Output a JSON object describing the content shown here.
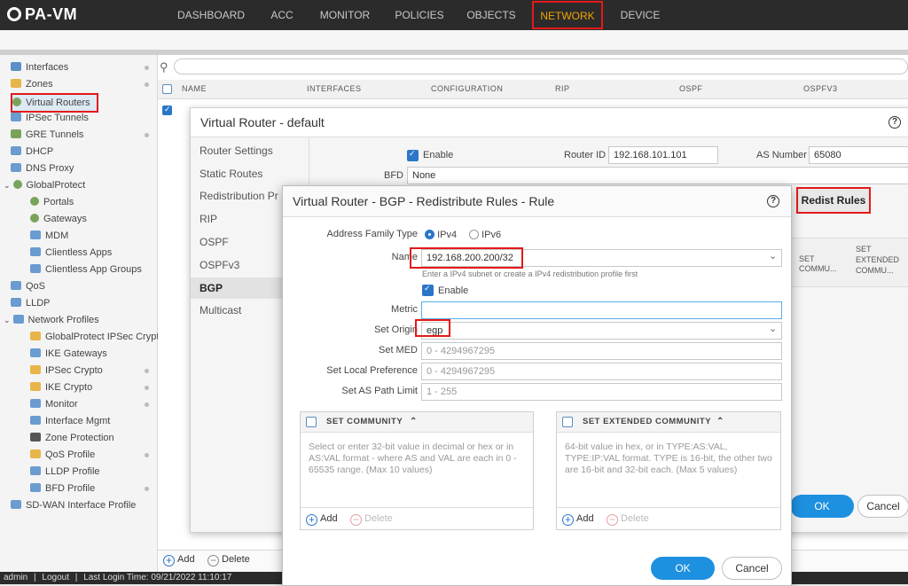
{
  "app": {
    "logo": "PA-VM"
  },
  "nav": [
    "DASHBOARD",
    "ACC",
    "MONITOR",
    "POLICIES",
    "OBJECTS",
    "NETWORK",
    "DEVICE"
  ],
  "sidebar": [
    "Interfaces",
    "Zones",
    "Virtual Routers",
    "IPSec Tunnels",
    "GRE Tunnels",
    "DHCP",
    "DNS Proxy",
    "GlobalProtect",
    "Portals",
    "Gateways",
    "MDM",
    "Clientless Apps",
    "Clientless App Groups",
    "QoS",
    "LLDP",
    "Network Profiles",
    "GlobalProtect IPSec Crypto",
    "IKE Gateways",
    "IPSec Crypto",
    "IKE Crypto",
    "Monitor",
    "Interface Mgmt",
    "Zone Protection",
    "QoS Profile",
    "LLDP Profile",
    "BFD Profile",
    "SD-WAN Interface Profile"
  ],
  "table": {
    "headers": [
      "NAME",
      "INTERFACES",
      "CONFIGURATION",
      "RIP",
      "OSPF",
      "OSPFV3"
    ]
  },
  "bottom_tools": {
    "add": "Add",
    "delete": "Delete"
  },
  "status": {
    "user": "admin",
    "logout": "Logout",
    "last_login": "Last Login Time: 09/21/2022 11:10:17"
  },
  "vr_dialog": {
    "title": "Virtual Router - default",
    "nav": [
      "Router Settings",
      "Static Routes",
      "Redistribution Pr",
      "RIP",
      "OSPF",
      "OSPFv3",
      "BGP",
      "Multicast"
    ],
    "enable": "Enable",
    "router_id_label": "Router ID",
    "router_id": "192.168.101.101",
    "as_label": "AS Number",
    "as_number": "65080",
    "bfd_label": "BFD",
    "bfd": "None",
    "redist_tab": "Redist Rules",
    "col_set_community": "SET COMMU...",
    "col_set_ext_1": "SET",
    "col_set_ext_2": "EXTENDED",
    "col_set_ext_3": "COMMU...",
    "col_set_comm_1": "SET",
    "col_set_comm_2": "COMMU...",
    "ok": "OK",
    "cancel": "Cancel"
  },
  "rule_dialog": {
    "title": "Virtual Router - BGP - Redistribute Rules - Rule",
    "addr_family_label": "Address Family Type",
    "ipv4": "IPv4",
    "ipv6": "IPv6",
    "name_label": "Name",
    "name_value": "192.168.200.200/32",
    "name_hint": "Enter a IPv4 subnet or create a IPv4 redistribution profile first",
    "enable": "Enable",
    "metric_label": "Metric",
    "set_origin_label": "Set Origin",
    "set_origin": "egp",
    "set_med_label": "Set MED",
    "set_med_ph": "0 - 4294967295",
    "set_lp_label": "Set Local Preference",
    "set_lp_ph": "0 - 4294967295",
    "set_aspath_label": "Set AS Path Limit",
    "set_aspath_ph": "1 - 255",
    "community_head": "SET COMMUNITY",
    "community_help": "Select or enter 32-bit value in decimal or hex or in AS:VAL format - where AS and VAL are each in 0 - 65535 range. (Max 10 values)",
    "ext_head": "SET EXTENDED COMMUNITY",
    "ext_help": "64-bit value in hex, or in TYPE:AS:VAL, TYPE:IP:VAL format. TYPE is 16-bit, the other two are 16-bit and 32-bit each. (Max 5 values)",
    "add": "Add",
    "delete": "Delete",
    "ok": "OK",
    "cancel": "Cancel"
  },
  "colors": {
    "accent": "#1e90e0",
    "highlight": "#e31a1a",
    "active_tab": "#f0a500"
  }
}
